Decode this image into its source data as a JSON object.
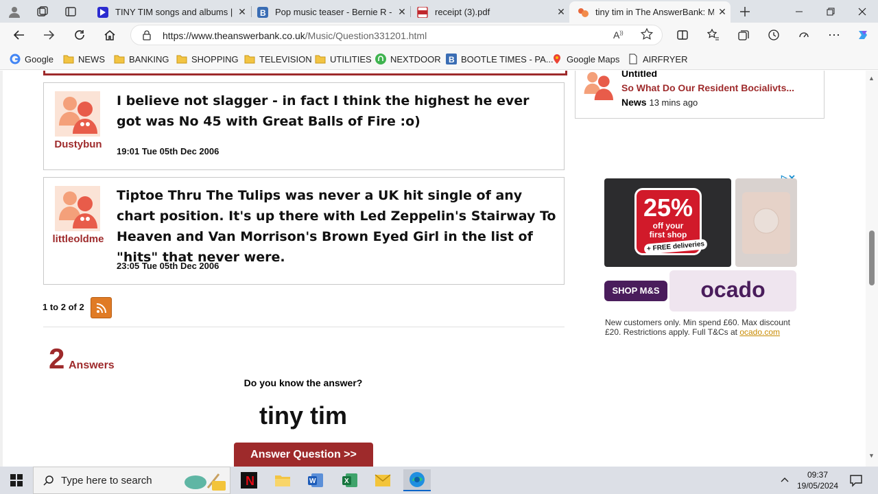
{
  "browser": {
    "tabs": [
      {
        "title": "TINY TIM songs and albums | fu",
        "favicon": "tiny-tim-favicon"
      },
      {
        "title": "Pop music teaser - Bernie R - Pa",
        "favicon": "bootle-b-favicon"
      },
      {
        "title": "receipt (3).pdf",
        "favicon": "pdf-favicon"
      },
      {
        "title": "tiny tim in The AnswerBank: Mu",
        "favicon": "answerbank-favicon"
      }
    ],
    "url_host": "https://www.theanswerbank.co.uk",
    "url_path": "/Music/Question331201.html",
    "bookmarks": [
      {
        "label": "Google",
        "icon": "google-icon"
      },
      {
        "label": "NEWS",
        "icon": "folder-icon"
      },
      {
        "label": "BANKING",
        "icon": "folder-icon"
      },
      {
        "label": "SHOPPING",
        "icon": "folder-icon"
      },
      {
        "label": "TELEVISION",
        "icon": "folder-icon"
      },
      {
        "label": "UTILITIES",
        "icon": "folder-icon"
      },
      {
        "label": "NEXTDOOR",
        "icon": "nextdoor-icon"
      },
      {
        "label": "BOOTLE TIMES - PA...",
        "icon": "bootle-b-icon"
      },
      {
        "label": "Google Maps",
        "icon": "maps-pin-icon"
      },
      {
        "label": "AIRFRYER",
        "icon": "document-icon"
      }
    ]
  },
  "posts": [
    {
      "user": "Dustybun",
      "text": "I believe not slagger - in fact I think the highest he ever got was No 45 with Great Balls of Fire :o)",
      "date": "19:01 Tue 05th Dec 2006"
    },
    {
      "user": "littleoldme",
      "text": "Tiptoe Thru The Tulips was never a UK hit single of any chart position. It's up there with Led Zeppelin's Stairway To Heaven and Van Morrison's Brown Eyed Girl in the list of \"hits\" that never were.",
      "date": "23:05 Tue 05th Dec 2006"
    }
  ],
  "pager": "1 to 2 of 2",
  "answers": {
    "count": "2",
    "label": "Answers"
  },
  "question": {
    "prompt": "Do you know the answer?",
    "title": "tiny tim",
    "button": "Answer Question >>"
  },
  "sidebar": {
    "title": "Untitled",
    "link": "So What Do Our Resident Bocialivts...",
    "category": "News",
    "ago": "13 mins ago"
  },
  "ad": {
    "percent": "25%",
    "offer_line1": "off your",
    "offer_line2": "first shop",
    "free": "+ FREE deliveries",
    "brand_ms": "SHOP M&S",
    "brand_ocado": "ocado",
    "terms": "New customers only. Min spend £60. Max discount £20. Restrictions apply. Full T&Cs at ",
    "terms_link": "ocado.com"
  },
  "taskbar": {
    "search_placeholder": "Type here to search",
    "time": "09:37",
    "date": "19/05/2024"
  },
  "colors": {
    "brand_red": "#9e2a2b",
    "rss_orange": "#e07b25",
    "ocado_purple": "#4a1d5c",
    "ad_red": "#d11a2a"
  }
}
